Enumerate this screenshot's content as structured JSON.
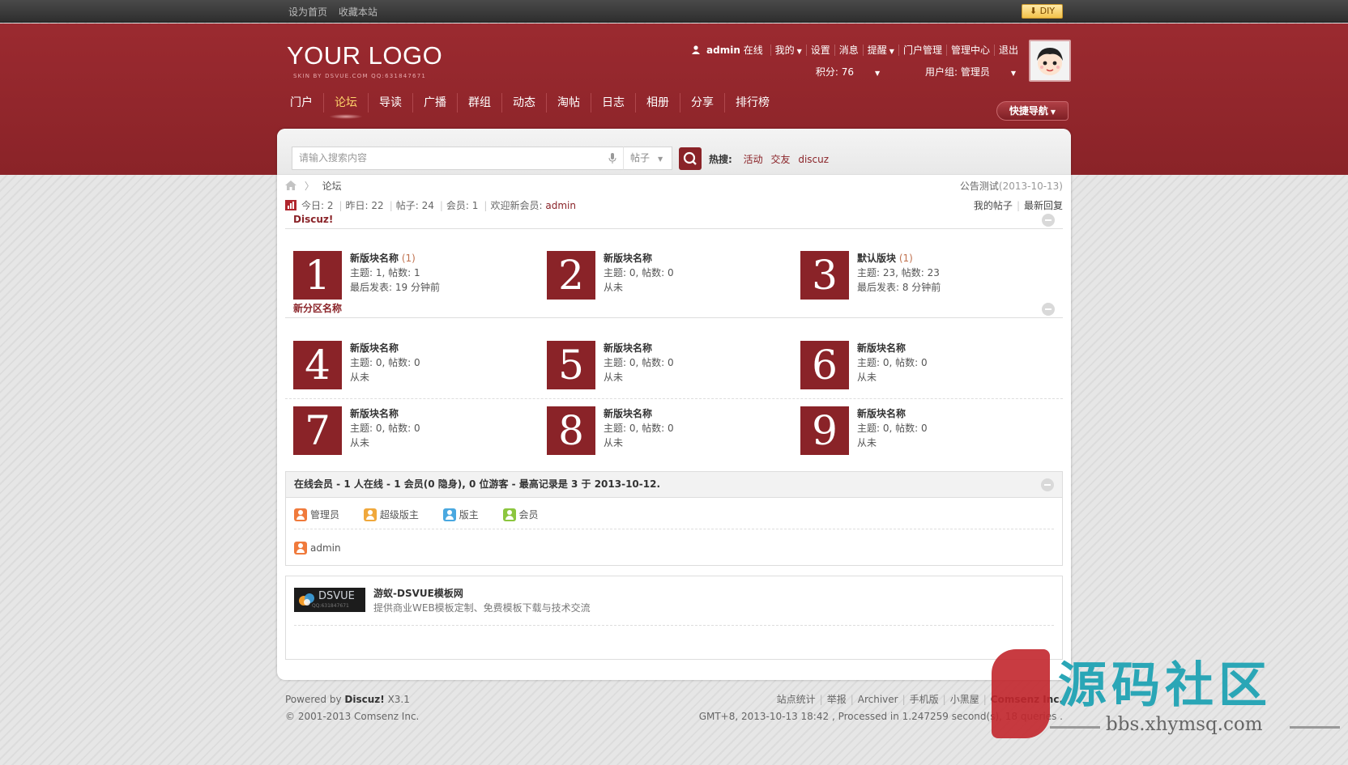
{
  "topbar": {
    "links": [
      "设为首页",
      "收藏本站"
    ],
    "diy_label": "DIY"
  },
  "header": {
    "logo": "YOUR LOGO",
    "logo_sub": "SKIN BY DSVUE.COM QQ:631847671",
    "user": {
      "name": "admin",
      "status": "在线",
      "items": [
        "我的",
        "设置",
        "消息",
        "提醒",
        "门户管理",
        "管理中心",
        "退出"
      ],
      "points": "积分: 76",
      "group": "用户组: 管理员"
    },
    "nav": [
      "门户",
      "论坛",
      "导读",
      "广播",
      "群组",
      "动态",
      "淘帖",
      "日志",
      "相册",
      "分享",
      "排行榜"
    ],
    "quicknav": "快捷导航"
  },
  "search": {
    "placeholder": "请输入搜索内容",
    "type": "帖子",
    "hot_label": "热搜:",
    "hot_keywords": [
      "活动",
      "交友",
      "discuz"
    ]
  },
  "breadcrumb": {
    "current": "论坛"
  },
  "notice": {
    "text": "公告测试",
    "date": "(2013-10-13)"
  },
  "stats": {
    "today": "今日: 2",
    "yesterday": "昨日: 22",
    "posts": "帖子: 24",
    "members": "会员: 1",
    "welcome": "欢迎新会员:",
    "newest": "admin"
  },
  "mylinks": [
    "我的帖子",
    "最新回复"
  ],
  "categories": [
    {
      "name": "Discuz!",
      "boards": [
        {
          "num": "1",
          "title": "新版块名称",
          "today": "(1)",
          "counts": "主题: 1, 帖数: 1",
          "last": "最后发表: 19 分钟前"
        },
        {
          "num": "2",
          "title": "新版块名称",
          "today": "",
          "counts": "主题: 0, 帖数: 0",
          "last": "从未"
        },
        {
          "num": "3",
          "title": "默认版块",
          "today": "(1)",
          "counts": "主题: 23, 帖数: 23",
          "last": "最后发表: 8 分钟前"
        }
      ]
    },
    {
      "name": "新分区名称",
      "boards": [
        {
          "num": "4",
          "title": "新版块名称",
          "counts": "主题: 0, 帖数: 0",
          "last": "从未"
        },
        {
          "num": "5",
          "title": "新版块名称",
          "counts": "主题: 0, 帖数: 0",
          "last": "从未"
        },
        {
          "num": "6",
          "title": "新版块名称",
          "counts": "主题: 0, 帖数: 0",
          "last": "从未"
        },
        {
          "num": "7",
          "title": "新版块名称",
          "counts": "主题: 0, 帖数: 0",
          "last": "从未"
        },
        {
          "num": "8",
          "title": "新版块名称",
          "counts": "主题: 0, 帖数: 0",
          "last": "从未"
        },
        {
          "num": "9",
          "title": "新版块名称",
          "counts": "主题: 0, 帖数: 0",
          "last": "从未"
        }
      ]
    }
  ],
  "online": {
    "header": "在线会员 - 1 人在线 - 1 会员(0 隐身), 0 位游客 - 最高记录是 3 于 2013-10-12.",
    "legend": [
      "管理员",
      "超级版主",
      "版主",
      "会员"
    ],
    "users": [
      "admin"
    ]
  },
  "links": {
    "logo_text": "DSVUE",
    "logo_sub": "QQ:631847671",
    "name": "游蚁-DSVUE模板网",
    "desc": "提供商业WEB模板定制、免费模板下载与技术交流"
  },
  "footer": {
    "powered_prefix": "Powered by",
    "powered_brand": "Discuz!",
    "powered_version": "X3.1",
    "copyright": "© 2001-2013 Comsenz Inc.",
    "links": [
      "站点统计",
      "举报",
      "Archiver",
      "手机版",
      "小黑屋"
    ],
    "company": "Comsenz Inc.",
    "processed": "GMT+8, 2013-10-13 18:42 , Processed in 1.247259 second(s), 18 queries ."
  },
  "watermark": {
    "title": "源码社区",
    "url": "bbs.xhymsq.com"
  },
  "colors": {
    "brand": "#8a2328",
    "accent_hot": "#ffd36b",
    "admin_icon": "#f07a3c",
    "super_mod_icon": "#f0a83c",
    "mod_icon": "#4aa8e0",
    "member_icon": "#8cc63f"
  }
}
